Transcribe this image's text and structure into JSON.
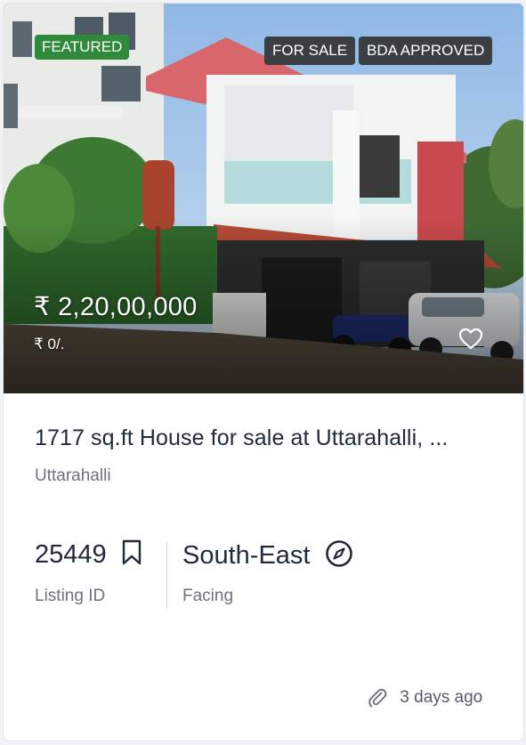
{
  "badges": {
    "featured": "FEATURED",
    "for_sale": "FOR SALE",
    "bda": "BDA APPROVED"
  },
  "price": {
    "main": "₹ 2,20,00,000",
    "sub": "₹ 0/."
  },
  "listing": {
    "title": "1717 sq.ft House for sale at Uttarahalli, ...",
    "location": "Uttarahalli"
  },
  "stats": {
    "listing_id": {
      "value": "25449",
      "label": "Listing ID",
      "icon": "bookmark-icon"
    },
    "facing": {
      "value": "South-East",
      "label": "Facing",
      "icon": "compass-icon"
    }
  },
  "footer": {
    "posted": "3 days ago",
    "icon": "paperclip-icon"
  },
  "colors": {
    "featured_badge": "#2f8a3b",
    "dark_badge": "#3b3f44",
    "text_primary": "#1f2a3a",
    "text_secondary": "#6b7280"
  }
}
